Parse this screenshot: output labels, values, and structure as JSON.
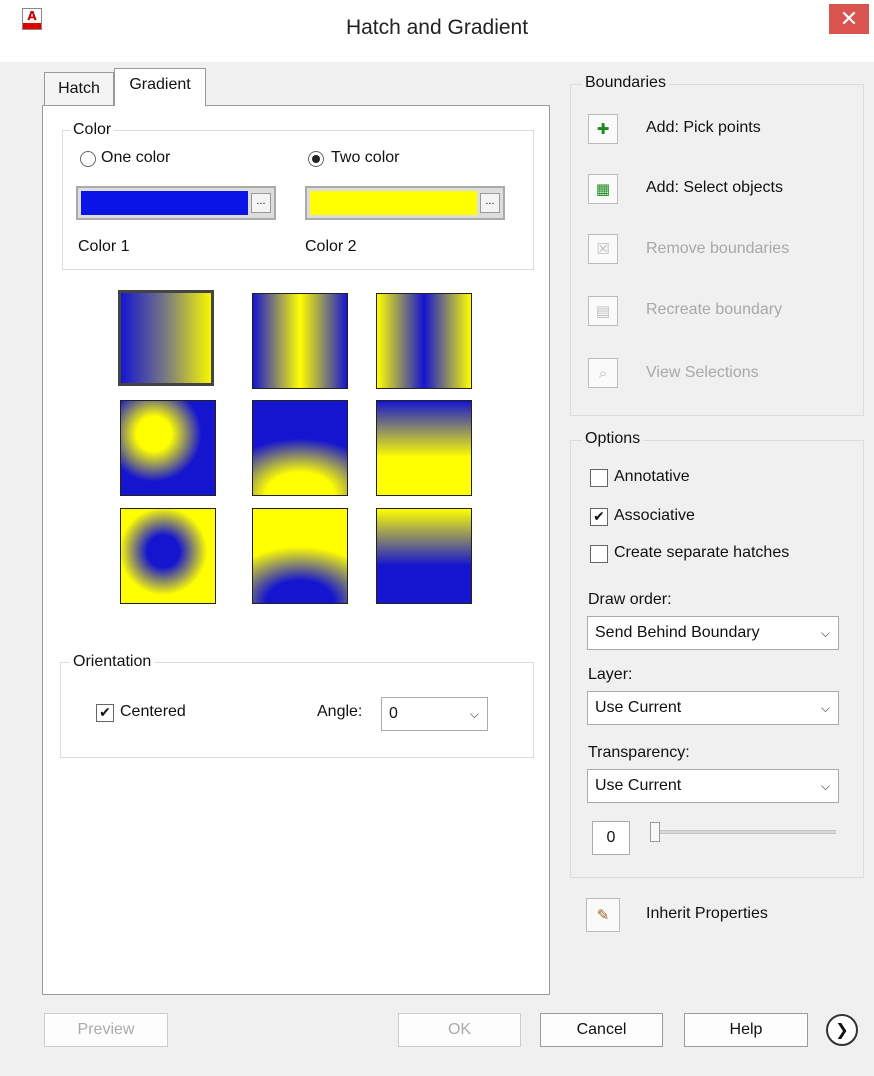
{
  "window": {
    "title": "Hatch and Gradient",
    "close_icon": "✕",
    "app_icon_letter": "A"
  },
  "tabs": [
    {
      "label": "Hatch"
    },
    {
      "label": "Gradient"
    }
  ],
  "color_group": {
    "legend": "Color",
    "one_color_label": "One color",
    "two_color_label": "Two color",
    "selected": "Two color",
    "color1": {
      "label": "Color 1",
      "value": "#0a14e6",
      "button": "..."
    },
    "color2": {
      "label": "Color 2",
      "value": "#ffff00",
      "button": "..."
    }
  },
  "gradient_patterns": [
    {
      "name": "linear-horizontal",
      "selected": true
    },
    {
      "name": "cylinder-vertical",
      "selected": false
    },
    {
      "name": "inverted-cylinder-vertical",
      "selected": false
    },
    {
      "name": "spherical",
      "selected": false
    },
    {
      "name": "hemispherical",
      "selected": false
    },
    {
      "name": "curved",
      "selected": false
    },
    {
      "name": "inverted-spherical",
      "selected": false
    },
    {
      "name": "inverted-hemispherical",
      "selected": false
    },
    {
      "name": "inverted-curved",
      "selected": false
    }
  ],
  "orientation": {
    "legend": "Orientation",
    "centered_label": "Centered",
    "centered": true,
    "angle_label": "Angle:",
    "angle_value": "0"
  },
  "boundaries": {
    "legend": "Boundaries",
    "buttons": [
      {
        "label": "Add: Pick points",
        "icon": "pick-points-icon",
        "glyph": "✚",
        "enabled": true
      },
      {
        "label": "Add: Select objects",
        "icon": "select-objects-icon",
        "glyph": "▦",
        "enabled": true
      },
      {
        "label": "Remove boundaries",
        "icon": "remove-boundaries-icon",
        "glyph": "☒",
        "enabled": false
      },
      {
        "label": "Recreate boundary",
        "icon": "recreate-boundary-icon",
        "glyph": "▤",
        "enabled": false
      },
      {
        "label": "View Selections",
        "icon": "magnifier-icon",
        "glyph": "⌕",
        "enabled": false
      }
    ]
  },
  "options": {
    "legend": "Options",
    "annotative": {
      "label": "Annotative",
      "checked": false
    },
    "associative": {
      "label": "Associative",
      "checked": true
    },
    "separate": {
      "label": "Create separate hatches",
      "checked": false
    },
    "draw_order": {
      "label": "Draw order:",
      "value": "Send Behind Boundary"
    },
    "layer": {
      "label": "Layer:",
      "value": "Use Current"
    },
    "transparency": {
      "label": "Transparency:",
      "value": "Use Current",
      "amount": "0"
    }
  },
  "inherit": {
    "label": "Inherit Properties",
    "icon": "paintbrush-icon"
  },
  "footer": {
    "preview": "Preview",
    "ok": "OK",
    "cancel": "Cancel",
    "help": "Help",
    "more_icon": "❯"
  },
  "check_glyph": "✔",
  "dropdown_arrow": "⌵"
}
